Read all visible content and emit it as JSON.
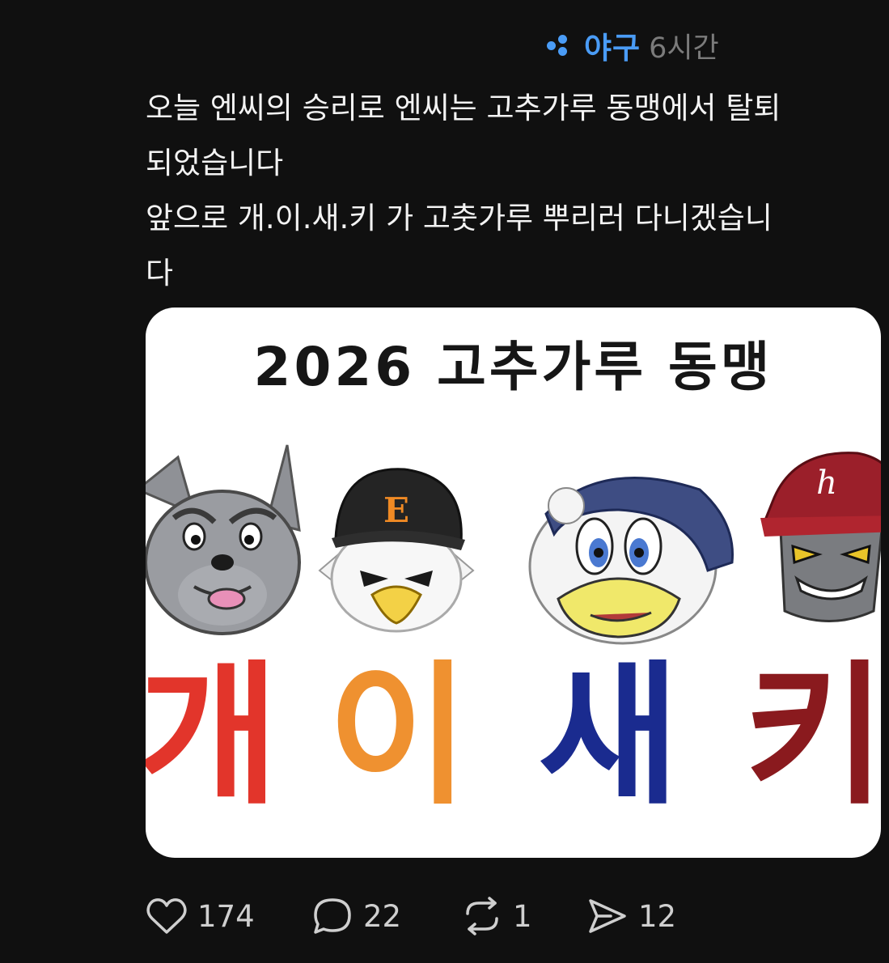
{
  "post": {
    "topic": "야구",
    "time": "6시간",
    "lines": [
      "오늘 엔씨의 승리로 엔씨는 고추가루 동맹에서 탈퇴",
      "되었습니다",
      "앞으로 개.이.새.키 가 고춧가루 뿌리러 다니겠습니",
      "다"
    ]
  },
  "media": {
    "title": "2026 고추가루 동맹",
    "letters": [
      "개",
      "이",
      "새",
      "키"
    ],
    "letter_colors": [
      "#e2352b",
      "#ef9130",
      "#1a2b8f",
      "#8a1a1e"
    ],
    "mascots": [
      "dog-mascot-icon",
      "eagle-mascot-icon",
      "dinosaur-mascot-icon",
      "hero-mascot-icon"
    ]
  },
  "actions": {
    "likes": "174",
    "replies": "22",
    "reposts": "1",
    "shares": "12"
  },
  "colors": {
    "background": "#101010",
    "accent": "#4a9cf6",
    "text": "#f3f3f3",
    "muted": "#7b7b7b"
  }
}
